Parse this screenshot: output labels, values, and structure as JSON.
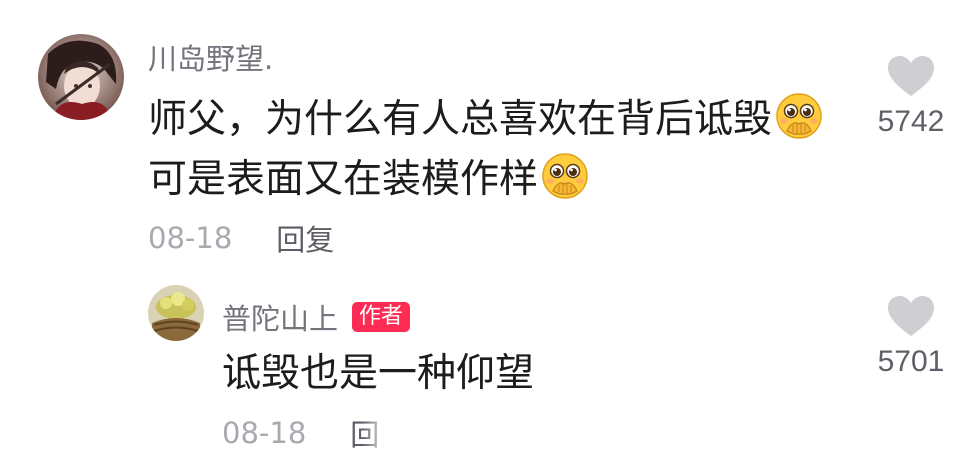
{
  "comment": {
    "username": "川岛野望.",
    "text_part1": "师父，为什么有人总喜欢在背后诋毁",
    "text_part2": "可是表面又在装模作样",
    "emoji_icon": "pleading-face-hands-over-mouth-emoji",
    "date": "08-18",
    "reply_label": "回复",
    "like_count": "5742",
    "like_icon": "heart-icon"
  },
  "reply": {
    "username": "普陀山上",
    "author_badge": "作者",
    "badge_color": "#fd2c55",
    "text": "诋毁也是一种仰望",
    "date": "08-18",
    "reply_label_partial": "回",
    "like_count": "5701",
    "like_icon": "heart-icon"
  }
}
